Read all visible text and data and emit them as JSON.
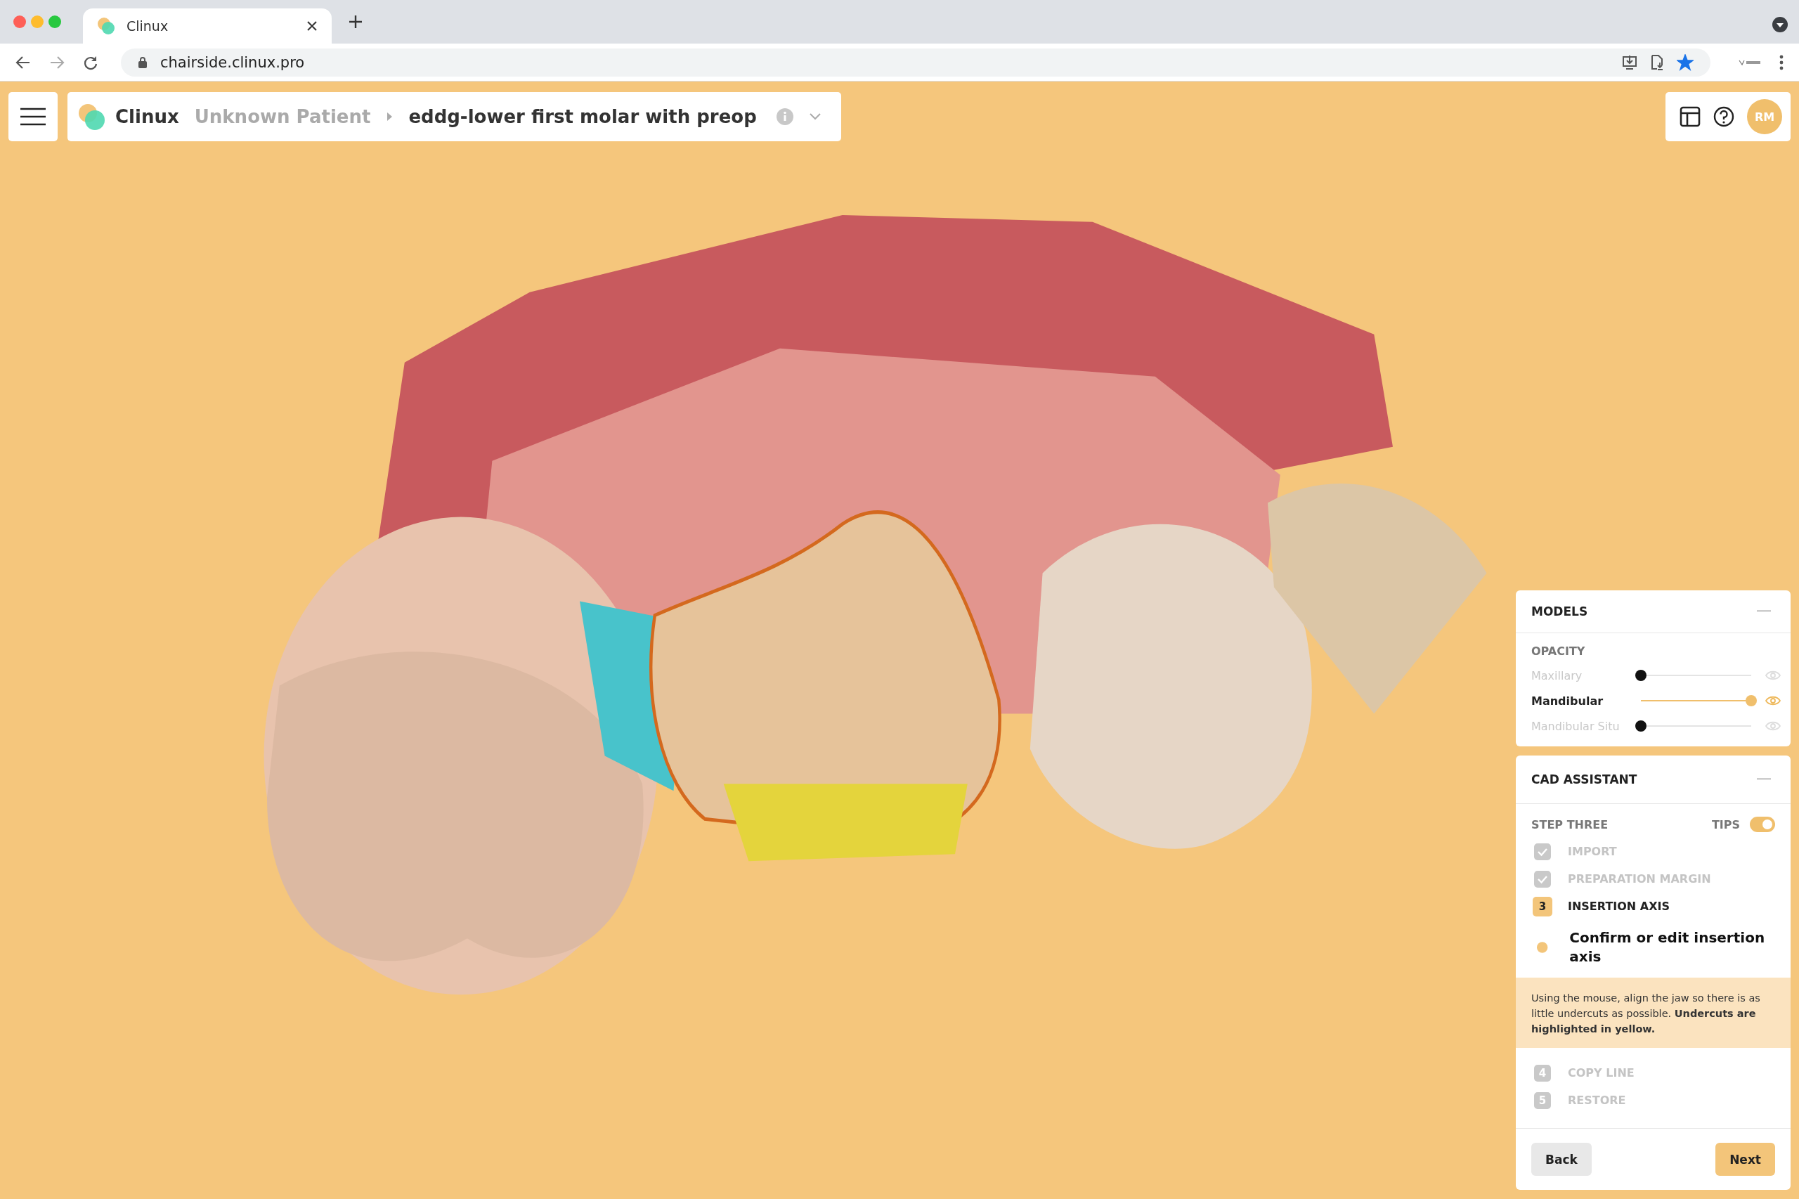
{
  "browser": {
    "tab_title": "Clinux",
    "address": "chairside.clinux.pro",
    "bookmarked": true
  },
  "app": {
    "brand": "Clinux",
    "breadcrumb": [
      {
        "text": "Unknown Patient",
        "current": false
      },
      {
        "text": "eddg-lower first molar with preop",
        "current": true
      }
    ],
    "avatar": "RM"
  },
  "models_panel": {
    "title": "MODELS",
    "section": "OPACITY",
    "models": [
      {
        "name": "Maxillary",
        "level": 0,
        "visible": false
      },
      {
        "name": "Mandibular",
        "level": 1,
        "visible": true
      },
      {
        "name": "Mandibular Situ",
        "level": 0,
        "visible": false
      }
    ]
  },
  "cad_panel": {
    "title": "CAD ASSISTANT",
    "step_title": "STEP THREE",
    "tips_label": "TIPS",
    "tips_on": true,
    "steps": [
      {
        "completed": true,
        "current": false,
        "label": "IMPORT"
      },
      {
        "completed": true,
        "current": false,
        "label": "PREPARATION MARGIN"
      },
      {
        "completed": false,
        "current": true,
        "number": "3",
        "label": "INSERTION AXIS",
        "substep": "Confirm or edit insertion axis",
        "tip": "Using the mouse, align the jaw so there is as little undercuts as possible. **Undercuts are highlighted in yellow.**"
      },
      {
        "completed": false,
        "current": false,
        "number": "4",
        "label": "COPY LINE"
      },
      {
        "completed": false,
        "current": false,
        "number": "5",
        "label": "RESTORE"
      }
    ],
    "buttons": [
      {
        "label": "Back",
        "kind": "secondary"
      },
      {
        "label": "Next",
        "kind": "primary"
      }
    ]
  }
}
